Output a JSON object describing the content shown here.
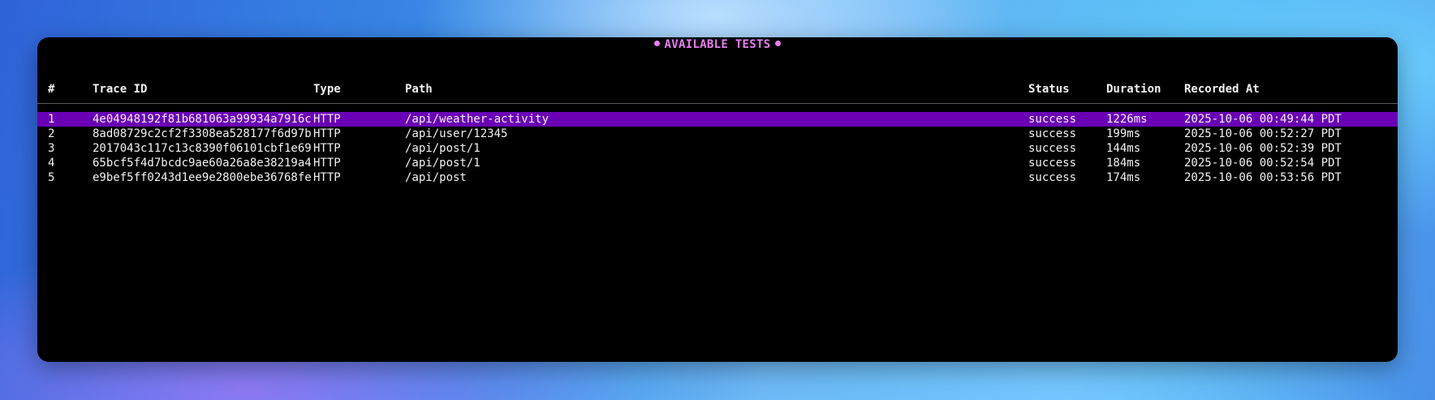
{
  "title": "AVAILABLE TESTS",
  "columns": {
    "num": "#",
    "trace_id": "Trace ID",
    "type": "Type",
    "path": "Path",
    "status": "Status",
    "duration": "Duration",
    "recorded_at": "Recorded At"
  },
  "rows": [
    {
      "num": "1",
      "trace_id": "4e04948192f81b681063a99934a7916c",
      "type": "HTTP",
      "path": "/api/weather-activity",
      "status": "success",
      "duration": "1226ms",
      "recorded_at": "2025-10-06 00:49:44 PDT"
    },
    {
      "num": "2",
      "trace_id": "8ad08729c2cf2f3308ea528177f6d97b",
      "type": "HTTP",
      "path": "/api/user/12345",
      "status": "success",
      "duration": "199ms",
      "recorded_at": "2025-10-06 00:52:27 PDT"
    },
    {
      "num": "3",
      "trace_id": "2017043c117c13c8390f06101cbf1e69",
      "type": "HTTP",
      "path": "/api/post/1",
      "status": "success",
      "duration": "144ms",
      "recorded_at": "2025-10-06 00:52:39 PDT"
    },
    {
      "num": "4",
      "trace_id": "65bcf5f4d7bcdc9ae60a26a8e38219a4",
      "type": "HTTP",
      "path": "/api/post/1",
      "status": "success",
      "duration": "184ms",
      "recorded_at": "2025-10-06 00:52:54 PDT"
    },
    {
      "num": "5",
      "trace_id": "e9bef5ff0243d1ee9e2800ebe36768fe",
      "type": "HTTP",
      "path": "/api/post",
      "status": "success",
      "duration": "174ms",
      "recorded_at": "2025-10-06 00:53:56 PDT"
    }
  ],
  "selected_row": "1",
  "colors": {
    "title": "#e77ff0",
    "selected_row_bg": "#6a00b5",
    "terminal_bg": "#000000",
    "text": "#f2f2f2"
  }
}
